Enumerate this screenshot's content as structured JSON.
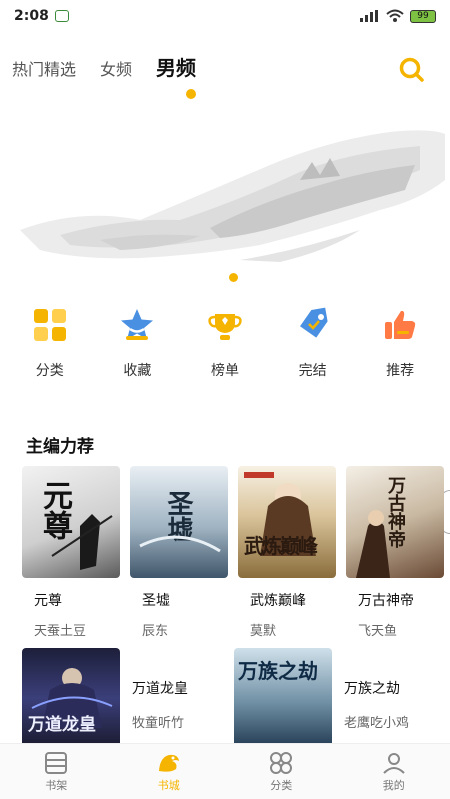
{
  "status": {
    "time": "2:08",
    "battery": "99"
  },
  "tabs": [
    {
      "label": "热门精选"
    },
    {
      "label": "女频"
    },
    {
      "label": "男频"
    }
  ],
  "categories": [
    {
      "label": "分类",
      "icon": "grid-icon"
    },
    {
      "label": "收藏",
      "icon": "star-icon"
    },
    {
      "label": "榜单",
      "icon": "trophy-icon"
    },
    {
      "label": "完结",
      "icon": "tag-icon"
    },
    {
      "label": "推荐",
      "icon": "thumbs-up-icon"
    }
  ],
  "section": {
    "title": "主编力荐"
  },
  "books": [
    {
      "title": "元尊",
      "author": "天蚕土豆",
      "cover_text": "元尊"
    },
    {
      "title": "圣墟",
      "author": "辰东",
      "cover_text": "圣墟"
    },
    {
      "title": "武炼巅峰",
      "author": "莫默",
      "cover_text": "武炼巅峰"
    },
    {
      "title": "万古神帝",
      "author": "飞天鱼",
      "cover_text": "万古神帝"
    }
  ],
  "books2": [
    {
      "title": "万道龙皇",
      "author": "牧童听竹",
      "cover_text": "万道龙皇"
    },
    {
      "title": "万族之劫",
      "author": "老鹰吃小鸡",
      "cover_text": "万族之劫"
    }
  ],
  "nav": [
    {
      "label": "书架",
      "icon": "bookshelf-icon"
    },
    {
      "label": "书城",
      "icon": "bookstore-icon"
    },
    {
      "label": "分类",
      "icon": "category-icon"
    },
    {
      "label": "我的",
      "icon": "profile-icon"
    }
  ],
  "colors": {
    "accent": "#f5b400",
    "primary_icon": "#4a90e2",
    "hot": "#ff7a45"
  }
}
